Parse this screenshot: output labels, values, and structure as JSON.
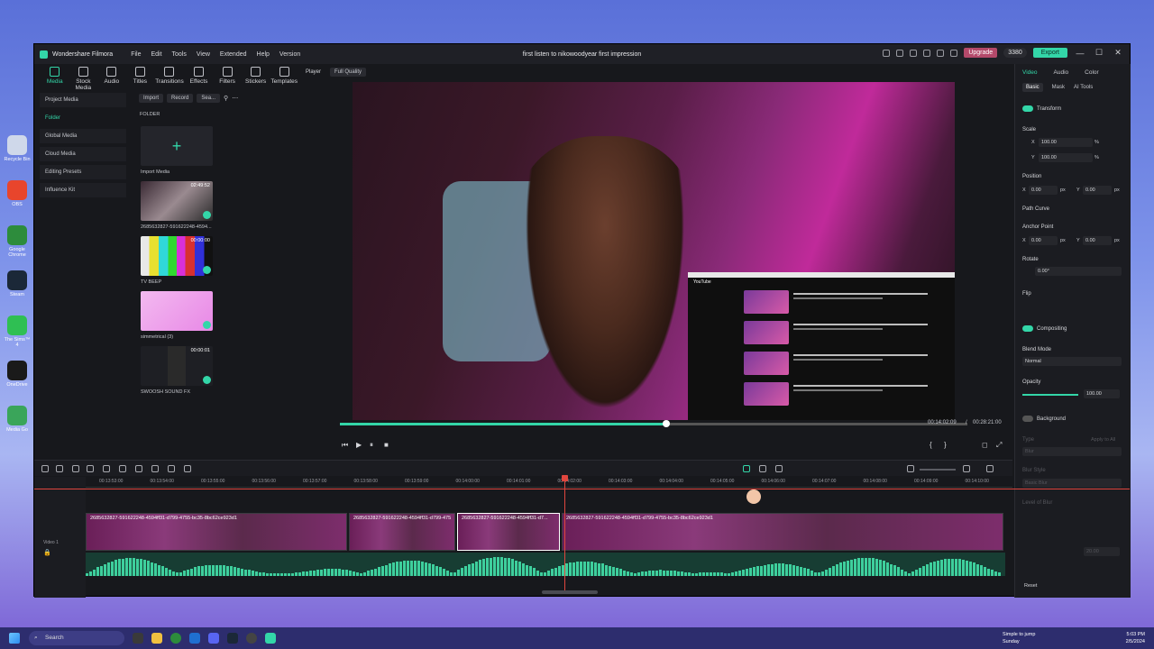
{
  "desktop": {
    "icons": [
      {
        "label": "Recycle Bin",
        "color": "#cfd8ea"
      },
      {
        "label": "OBS",
        "color": "#e8452c"
      },
      {
        "label": "Google Chrome",
        "color": "#2d8c3c"
      },
      {
        "label": "Steam",
        "color": "#1b2838"
      },
      {
        "label": "The Sims™ 4",
        "color": "#2fbf53"
      },
      {
        "label": "OneDrive",
        "color": "#1a1a1a"
      },
      {
        "label": "Media Go",
        "color": "#3aa55a"
      }
    ]
  },
  "app": {
    "name": "Wondershare Filmora",
    "title": "first listen to nikowoodyear first impression",
    "menu": [
      "File",
      "Edit",
      "Tools",
      "View",
      "Extended",
      "Help",
      "Version"
    ],
    "upgrade_label": "Upgrade",
    "credits": "3380",
    "export_label": "Export",
    "window_controls": [
      "—",
      "☐",
      "✕"
    ]
  },
  "toolbar": {
    "tools": [
      "Media",
      "Stock Media",
      "Audio",
      "Titles",
      "Transitions",
      "Effects",
      "Filters",
      "Stickers",
      "Templates"
    ]
  },
  "media": {
    "nav": [
      "Project Media",
      "Folder",
      "Global Media",
      "Cloud Media",
      "Editing Presets",
      "Influence Kit"
    ],
    "import_label": "Import",
    "record_label": "Record",
    "search_placeholder": "Sea...",
    "folder_label": "FOLDER",
    "items": [
      {
        "name": "Import Media",
        "duration": ""
      },
      {
        "name": "2685632827-591622248-4594...",
        "duration": "02:49:52"
      },
      {
        "name": "TV BEEP",
        "duration": "00:00:00"
      },
      {
        "name": "simmetrical (3)",
        "duration": ""
      },
      {
        "name": "SWOOSH SOUND FX",
        "duration": "00:00:01"
      }
    ]
  },
  "player": {
    "label": "Player",
    "quality": "Full Quality",
    "current_time": "00:14:02:09",
    "separator": "/",
    "total_time": "00:28:21:00",
    "progress": 0.52,
    "inset_title": "YouTube"
  },
  "properties": {
    "tabs": [
      "Video",
      "Audio",
      "Color"
    ],
    "subtabs": [
      "Basic",
      "Mask",
      "AI Tools"
    ],
    "transform_label": "Transform",
    "scale_label": "Scale",
    "scale_x": "100.00",
    "scale_y": "100.00",
    "scale_unit": "%",
    "position_label": "Position",
    "pos_x": "0.00",
    "pos_y": "0.00",
    "px_unit": "px",
    "path_curve_label": "Path Curve",
    "anchor_label": "Anchor Point",
    "anchor_x": "0.00",
    "anchor_y": "0.00",
    "rotate_label": "Rotate",
    "rotate_value": "0.00°",
    "flip_label": "Flip",
    "compositing_label": "Compositing",
    "blend_label": "Blend Mode",
    "blend_value": "Normal",
    "opacity_label": "Opacity",
    "opacity_value": "100.00",
    "opacity": 1.0,
    "background_label": "Background",
    "type_label": "Type",
    "type_value": "Blur",
    "apply_all": "Apply to All",
    "blur_style_label": "Blur Style",
    "blur_style_value": "Basic Blur",
    "level_label": "Level of Blur",
    "level_value": "20.00",
    "reset_label": "Reset"
  },
  "timeline": {
    "ruler": [
      "00:13:53:00",
      "00:13:54:00",
      "00:13:55:00",
      "00:13:56:00",
      "00:13:57:00",
      "00:13:58:00",
      "00:13:59:00",
      "00:14:00:00",
      "00:14:01:00",
      "00:14:02:00",
      "00:14:03:00",
      "00:14:04:00",
      "00:14:05:00",
      "00:14:06:00",
      "00:14:07:00",
      "00:14:08:00",
      "00:14:09:00",
      "00:14:10:00"
    ],
    "track_label": "Video 1",
    "clips": [
      "2685632827-591622248-4594ff31-d799-4755-bc35-8bc62ce923d1",
      "2685632827-591622248-4594ff31-d799-4755-bc35-8bc62ce923d1",
      "2685632827-591622248-4594ff31-d7...",
      "2685632827-591622248-4594ff31-d799-4755-bc35-8bc62ce923d1"
    ]
  },
  "taskbar": {
    "search_placeholder": "Search",
    "weather_line1": "Simple to jump",
    "weather_line2": "Sunday",
    "time": "5:03 PM",
    "date": "2/5/2024"
  }
}
